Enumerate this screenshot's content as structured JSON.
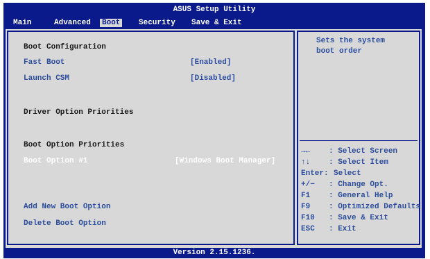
{
  "app": {
    "title": "ASUS Setup Utility",
    "version": "Version 2.15.1236."
  },
  "menu": {
    "items": [
      {
        "label": "Main",
        "active": false
      },
      {
        "label": "Advanced",
        "active": false
      },
      {
        "label": "Boot",
        "active": true
      },
      {
        "label": "Security",
        "active": false
      },
      {
        "label": "Save & Exit",
        "active": false
      }
    ]
  },
  "boot": {
    "section_config": "Boot Configuration",
    "fast_boot": {
      "label": "Fast Boot",
      "value": "[Enabled]"
    },
    "launch_csm": {
      "label": "Launch CSM",
      "value": "[Disabled]"
    },
    "section_driver": "Driver Option Priorities",
    "section_boot": "Boot Option Priorities",
    "boot_option_1": {
      "label": "Boot Option #1",
      "value": "[Windows Boot Manager]"
    },
    "add_new": "Add New Boot Option",
    "delete": "Delete Boot Option"
  },
  "help": {
    "line1": "Sets the system",
    "line2": "boot order"
  },
  "keys": [
    {
      "key": "→←",
      "desc": ": Select Screen"
    },
    {
      "key": "↑↓",
      "desc": ": Select Item"
    },
    {
      "key": "Enter:",
      "desc": "Select"
    },
    {
      "key": "+/−",
      "desc": ": Change Opt."
    },
    {
      "key": "F1",
      "desc": ": General Help"
    },
    {
      "key": "F9",
      "desc": ": Optimized Defaults"
    },
    {
      "key": "F10",
      "desc": ": Save & Exit"
    },
    {
      "key": "ESC",
      "desc": ": Exit"
    }
  ],
  "colors": {
    "frame": "#0a1a8a",
    "panel": "#d8d8d8",
    "option_text": "#2b4d9e",
    "selected_text": "#ffffff",
    "header_text": "#1a1a1a"
  }
}
